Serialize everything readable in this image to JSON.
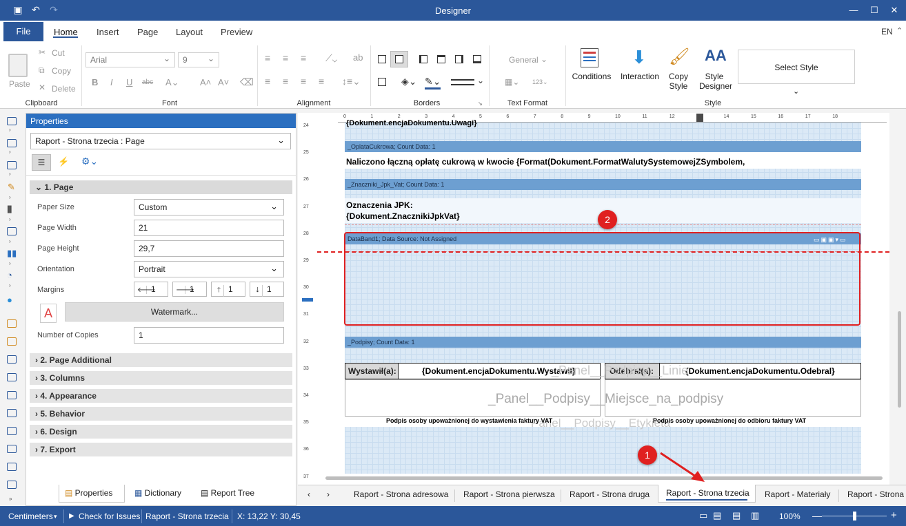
{
  "window": {
    "title": "Designer"
  },
  "menu": {
    "file": "File",
    "tabs": [
      "Home",
      "Insert",
      "Page",
      "Layout",
      "Preview"
    ],
    "language": "EN"
  },
  "ribbon": {
    "clipboard": {
      "group": "Clipboard",
      "paste": "Paste",
      "cut": "Cut",
      "copy": "Copy",
      "delete": "Delete"
    },
    "font": {
      "group": "Font",
      "family": "Arial",
      "size": "9"
    },
    "alignment": {
      "group": "Alignment"
    },
    "borders": {
      "group": "Borders"
    },
    "text_format": {
      "group": "Text Format",
      "format": "General"
    },
    "style": {
      "group": "Style",
      "conditions": "Conditions",
      "interaction": "Interaction",
      "copy_style": "Copy Style",
      "style_designer": "Style Designer",
      "select_style": "Select Style"
    }
  },
  "properties": {
    "title": "Properties",
    "object": "Raport - Strona trzecia : Page",
    "section_page": "1. Page",
    "fields": {
      "paper_size": {
        "label": "Paper Size",
        "value": "Custom"
      },
      "page_width": {
        "label": "Page Width",
        "value": "21"
      },
      "page_height": {
        "label": "Page Height",
        "value": "29,7"
      },
      "orientation": {
        "label": "Orientation",
        "value": "Portrait"
      },
      "margins": {
        "label": "Margins",
        "left": "1",
        "right": "1",
        "top": "1",
        "bottom": "1"
      },
      "watermark": "Watermark...",
      "copies": {
        "label": "Number of Copies",
        "value": "1"
      }
    },
    "sections": [
      "2. Page Additional",
      "3. Columns",
      "4. Appearance",
      "5. Behavior",
      "6. Design",
      "7. Export"
    ],
    "bottom_tabs": [
      "Properties",
      "Dictionary",
      "Report Tree"
    ]
  },
  "ruler": {
    "top": [
      "0",
      "1",
      "2",
      "3",
      "4",
      "5",
      "6",
      "7",
      "8",
      "9",
      "10",
      "11",
      "12",
      "13",
      "14",
      "15",
      "16",
      "17",
      "18"
    ],
    "left": [
      "24",
      "25",
      "26",
      "27",
      "28",
      "29",
      "30",
      "31",
      "32",
      "33",
      "34",
      "35",
      "36",
      "37"
    ]
  },
  "report": {
    "uwagi": "{Dokument.encjaDokumentu.Uwagi}",
    "oplata_band": "_OplataCukrowa; Count Data: 1",
    "oplata_text": "Naliczono łączną opłatę cukrową w kwocie {Format(Dokument.FormatWalutySystemowejZSymbolem,",
    "jpk_band": "_Znaczniki_Jpk_Vat; Count Data: 1",
    "jpk_text1": "Oznaczenia JPK:",
    "jpk_text2": "{Dokument.ZnacznikiJpkVat}",
    "databand": "DataBand1; Data Source: Not Assigned",
    "podpisy_band": "_Podpisy; Count Data: 1",
    "wystawil_label": "Wystawił(a):",
    "wystawil_value": "{Dokument.encjaDokumentu.Wystawil}",
    "odebral_label": "Odebrał(a):",
    "odebral_value": "{Dokument.encjaDokumentu.Odebral}",
    "watermark1": "_Panel__Podpisy__Miejsce_na_podpisy",
    "watermark2": "Panel__Podpisy__Etykieta",
    "watermark3": "_Panel__Podpisy__Linie",
    "sign1": "Podpis osoby upoważnionej do wystawienia faktury VAT",
    "sign2": "Podpis osoby upoważnionej do odbioru faktury VAT"
  },
  "report_tabs": [
    "Raport - Strona adresowa",
    "Raport - Strona pierwsza",
    "Raport - Strona druga",
    "Raport - Strona trzecia",
    "Raport - Materiały",
    "Raport - Strona"
  ],
  "annotations": {
    "badge1": "1",
    "badge2": "2"
  },
  "status": {
    "units": "Centimeters",
    "check": "Check for Issues",
    "page": "Raport - Strona trzecia",
    "coords": "X: 13,22 Y: 30,45",
    "zoom": "100%"
  },
  "colors": {
    "accent": "#2b579a",
    "highlight": "#e02020"
  }
}
